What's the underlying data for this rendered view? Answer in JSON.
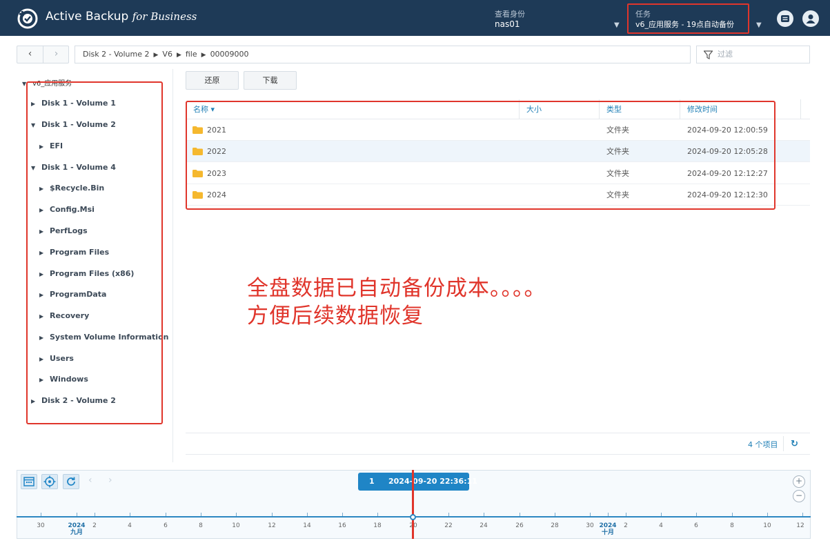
{
  "header": {
    "app_name": "Active Backup",
    "app_for": "for Business",
    "identity_label": "查看身份",
    "identity_value": "nas01",
    "task_label": "任务",
    "task_value": "v6_应用服务 - 19点自动备份"
  },
  "toolbar": {
    "back_label": "‹",
    "forward_label": "›",
    "breadcrumb": [
      "Disk 2 - Volume 2",
      "V6",
      "file",
      "00009000"
    ],
    "filter_placeholder": "过滤"
  },
  "tree": {
    "root": "v6_应用服务",
    "items": [
      {
        "label": "Disk 1 - Volume 1",
        "level": 1,
        "expanded": false
      },
      {
        "label": "Disk 1 - Volume 2",
        "level": 1,
        "expanded": true
      },
      {
        "label": "EFI",
        "level": 2,
        "expanded": false
      },
      {
        "label": "Disk 1 - Volume 4",
        "level": 1,
        "expanded": true
      },
      {
        "label": "$Recycle.Bin",
        "level": 2,
        "expanded": false
      },
      {
        "label": "Config.Msi",
        "level": 2,
        "expanded": false
      },
      {
        "label": "PerfLogs",
        "level": 2,
        "expanded": false
      },
      {
        "label": "Program Files",
        "level": 2,
        "expanded": false
      },
      {
        "label": "Program Files (x86)",
        "level": 2,
        "expanded": false
      },
      {
        "label": "ProgramData",
        "level": 2,
        "expanded": false
      },
      {
        "label": "Recovery",
        "level": 2,
        "expanded": false
      },
      {
        "label": "System Volume Information",
        "level": 2,
        "expanded": false
      },
      {
        "label": "Users",
        "level": 2,
        "expanded": false
      },
      {
        "label": "Windows",
        "level": 2,
        "expanded": false
      },
      {
        "label": "Disk 2 - Volume 2",
        "level": 1,
        "expanded": false
      }
    ]
  },
  "actions": {
    "restore_label": "还原",
    "download_label": "下载"
  },
  "table": {
    "columns": [
      "名称 ▾",
      "大小",
      "类型",
      "修改时间"
    ],
    "rows": [
      {
        "name": "2021",
        "size": "",
        "type": "文件夹",
        "modified": "2024-09-20 12:00:59"
      },
      {
        "name": "2022",
        "size": "",
        "type": "文件夹",
        "modified": "2024-09-20 12:05:28"
      },
      {
        "name": "2023",
        "size": "",
        "type": "文件夹",
        "modified": "2024-09-20 12:12:27"
      },
      {
        "name": "2024",
        "size": "",
        "type": "文件夹",
        "modified": "2024-09-20 12:12:30"
      }
    ],
    "count_label": "4 个项目",
    "selected_row": 1
  },
  "annotation": {
    "line1": "全盘数据已自动备份成本。。。。",
    "line2": "方便后续数据恢复"
  },
  "timeline": {
    "badge_number": "1",
    "badge_datetime": "2024-09-20 22:36:11",
    "ticks": [
      "30",
      "2",
      "4",
      "6",
      "8",
      "10",
      "12",
      "14",
      "16",
      "18",
      "20",
      "22",
      "24",
      "26",
      "28",
      "30",
      "2",
      "4",
      "6",
      "8",
      "10",
      "12"
    ],
    "year_markers": [
      {
        "year": "2024",
        "month": "九月"
      },
      {
        "year": "2024",
        "month": "十月"
      }
    ]
  },
  "colors": {
    "header_bg": "#1e3a57",
    "accent": "#1f85c6",
    "highlight": "#e0352b",
    "folder": "#f5b82e"
  }
}
